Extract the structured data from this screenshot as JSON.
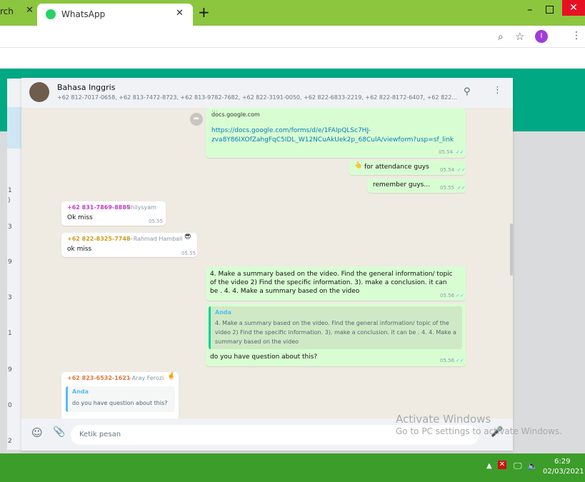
{
  "browser": {
    "prev_tab_label": "rch",
    "prev_tab_close": "✕",
    "active_tab_title": "WhatsApp",
    "active_tab_close": "✕",
    "new_tab": "+",
    "window_min": "–",
    "window_close": "✕",
    "zoom_icon": "⌕",
    "star_icon": "☆",
    "profile_initial": "I",
    "menu_icon": "⋮"
  },
  "sidebar": {
    "numbers": [
      "1",
      ")",
      "3",
      "9",
      "3",
      "1",
      "9",
      "0",
      "2"
    ]
  },
  "chat": {
    "header": {
      "name": "Bahasa Inggris",
      "members": "+62 812-7017-0658, +62 813-7472-8723, +62 813-9782-7682, +62 822-3191-0050, +62 822-6833-2219, +62 822-8172-6407, +62 822..."
    },
    "messages": {
      "m1": {
        "partial_line": "…",
        "domain": "docs.google.com",
        "url": "https://docs.google.com/forms/d/e/1FAIpQLSc7HJ-zva8Y86IXOfZahgFqC5IDL_W12NCuAkUek2p_68CulA/viewform?usp=sf_link",
        "time": "05.54",
        "tick": "✓✓"
      },
      "m2": {
        "emoji": "👆",
        "text": "for attendance guys",
        "time": "05.54",
        "tick": "✓✓"
      },
      "m3": {
        "text": "remember guys...",
        "time": "05.55",
        "tick": "✓✓"
      },
      "m4": {
        "phone": "+62 831-7869-8885",
        "alias": "~Ihilysyam",
        "text": "Ok miss",
        "time": "05.55"
      },
      "m5": {
        "phone": "+62 822-8325-7748",
        "alias": "~Rahmad Hambali",
        "emoji": "😎",
        "text": "ok miss",
        "time": "05.55"
      },
      "m6": {
        "text": "4. Make a summary based on the video. Find the general information/ topic of the video 2) Find the specific information. 3). make a conclusion. it can be . 4. 4. Make a summary based on the video",
        "time": "05.56",
        "tick": "✓✓"
      },
      "m7": {
        "quote_author": "Anda",
        "quote_text": "4. Make a summary based on the video. Find the general information/ topic of the video 2) Find the specific information. 3). make a conclusion. it can be . 4. 4. Make a summary based on the video",
        "text": "do you have question about this?",
        "time": "05.56",
        "tick": "✓✓"
      },
      "m8": {
        "phone": "+62 823-6532-1621",
        "alias": "~Aray Ferozi",
        "emoji": "🤞",
        "quote_author": "Anda",
        "quote_text": "do you have question about this?"
      }
    },
    "scroll_down": "⌄",
    "forward_icon": "➦",
    "composer": {
      "emoji_icon": "☺",
      "attach_icon": "📎",
      "placeholder": "Ketik pesan",
      "mic_icon": "🎤"
    }
  },
  "activation": {
    "title": "Activate Windows",
    "subtitle": "Go to PC settings to activate Windows."
  },
  "taskbar": {
    "up_icon": "▲",
    "x_icon": "✕",
    "chat_icon": "🖵",
    "volume_icon": "🔈",
    "time": "6:29",
    "date": "02/03/2021"
  }
}
